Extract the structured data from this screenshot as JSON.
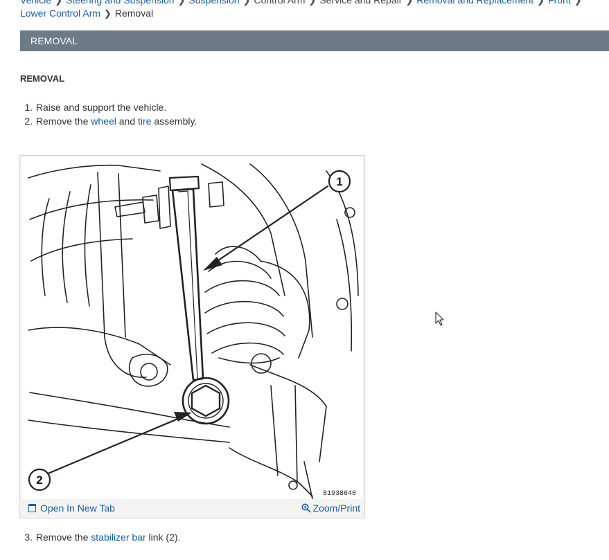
{
  "breadcrumb": {
    "row1": [
      "Vehicle",
      "Steering and Suspension",
      "Suspension",
      "Control Arm",
      "Service and Repair",
      "Removal and Replacement",
      "Front"
    ],
    "row1_linked": [
      true,
      true,
      true,
      false,
      false,
      true,
      true
    ],
    "row2_link": "Lower Control Arm",
    "current": "Removal"
  },
  "banner": {
    "title": "REMOVAL"
  },
  "section": {
    "heading": "REMOVAL"
  },
  "steps_before": [
    {
      "num": "1.",
      "parts": [
        {
          "text": "Raise and support the vehicle.",
          "link": false
        }
      ]
    },
    {
      "num": "2.",
      "parts": [
        {
          "text": "Remove the ",
          "link": false
        },
        {
          "text": "wheel",
          "link": true
        },
        {
          "text": " and ",
          "link": false
        },
        {
          "text": "tire",
          "link": true
        },
        {
          "text": " assembly.",
          "link": false
        }
      ]
    }
  ],
  "figure": {
    "image_id": "81938640",
    "callouts": [
      "1",
      "2"
    ],
    "open_tab_label": "Open In New Tab",
    "zoom_label": "Zoom/Print"
  },
  "steps_after": [
    {
      "num": "3.",
      "parts": [
        {
          "text": "Remove the ",
          "link": false
        },
        {
          "text": "stabilizer bar",
          "link": true
        },
        {
          "text": " link (2).",
          "link": false
        }
      ]
    }
  ],
  "colors": {
    "link": "#1a5fa8",
    "banner": "#6d7a87",
    "text": "#333333"
  }
}
